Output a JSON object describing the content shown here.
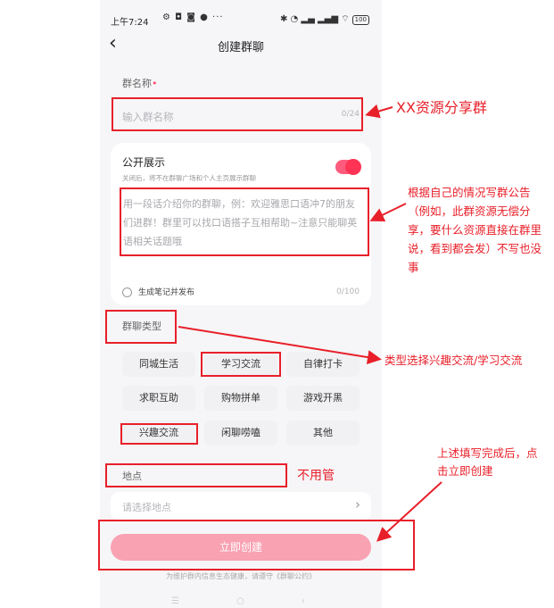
{
  "status": {
    "time": "上午7:24",
    "left_icons": "⚙ ◘ ◙ ● ···",
    "right_icons": "✱ ◔ ▂▄ ▂▄▆ ⌔",
    "battery": "100"
  },
  "nav": {
    "title": "创建群聊"
  },
  "name_field": {
    "label": "群名称",
    "required_mark": "•",
    "placeholder": "输入群名称",
    "counter": "0/24"
  },
  "public": {
    "title": "公开展示",
    "subtitle": "关闭后，将不在群聊广场和个人主页展示群聊",
    "toggle_on": true,
    "intro_placeholder": "用一段话介绍你的群聊，例：欢迎雅思口语冲7的朋友们进群！群里可以找口语搭子互相帮助~注意只能聊英语相关话题哦",
    "publish_note": "生成笔记并发布",
    "counter": "0/100"
  },
  "type": {
    "label": "群聊类型",
    "chips": [
      "同城生活",
      "学习交流",
      "自律打卡",
      "求职互助",
      "购物拼单",
      "游戏开黑",
      "兴趣交流",
      "闲聊唠嗑",
      "其他"
    ]
  },
  "location": {
    "label": "地点",
    "placeholder": "请选择地点"
  },
  "submit": {
    "label": "立即创建"
  },
  "footer": {
    "text": "为维护群内信息生态健康，请遵守《群聊公约》"
  },
  "annotations": {
    "name": "XX资源分享群",
    "intro": "根据自己的情况写群公告（例如，此群资源无偿分享，要什么资源直接在群里说，看到都会发）不写也没事",
    "type": "类型选择兴趣交流/学习交流",
    "location": "不用管",
    "submit": "上述填写完成后，点击立即创建"
  },
  "colors": {
    "accent": "#ff3355",
    "button": "#f8a2b2",
    "annotation": "#e8202a"
  }
}
